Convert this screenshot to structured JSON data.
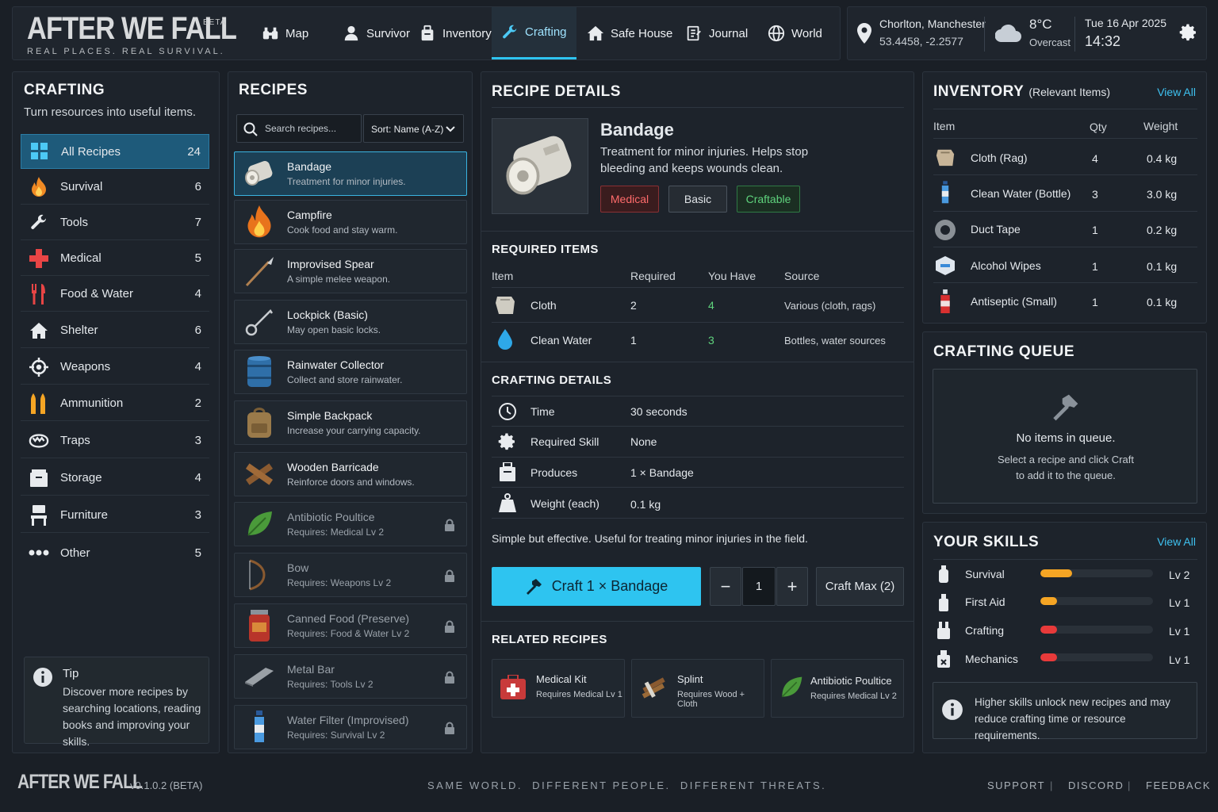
{
  "header": {
    "logo": "AFTER WE FALL",
    "beta": "BETA",
    "tagline": "REAL PLACES. REAL SURVIVAL.",
    "nav": [
      {
        "label": "Map",
        "icon": "binoculars-icon"
      },
      {
        "label": "Survivor",
        "icon": "person-icon"
      },
      {
        "label": "Inventory",
        "icon": "backpack-icon"
      },
      {
        "label": "Crafting",
        "icon": "wrench-icon",
        "active": true
      },
      {
        "label": "Safe House",
        "icon": "house-icon"
      },
      {
        "label": "Journal",
        "icon": "journal-icon"
      },
      {
        "label": "World",
        "icon": "globe-icon"
      }
    ],
    "location": "Chorlton, Manchester",
    "coords": "53.4458, -2.2577",
    "temp": "8°C",
    "weather": "Overcast",
    "date": "Tue 16 Apr 2025",
    "time": "14:32"
  },
  "sidebar": {
    "title": "CRAFTING",
    "subtitle": "Turn resources into useful items.",
    "categories": [
      {
        "label": "All Recipes",
        "count": "24",
        "icon": "grid-icon"
      },
      {
        "label": "Survival",
        "count": "6",
        "icon": "fire-icon"
      },
      {
        "label": "Tools",
        "count": "7",
        "icon": "wrench-icon"
      },
      {
        "label": "Medical",
        "count": "5",
        "icon": "medical-cross-icon"
      },
      {
        "label": "Food & Water",
        "count": "4",
        "icon": "cutlery-icon"
      },
      {
        "label": "Shelter",
        "count": "6",
        "icon": "house-icon"
      },
      {
        "label": "Weapons",
        "count": "4",
        "icon": "crosshair-icon"
      },
      {
        "label": "Ammunition",
        "count": "2",
        "icon": "bullets-icon"
      },
      {
        "label": "Traps",
        "count": "3",
        "icon": "trap-icon"
      },
      {
        "label": "Storage",
        "count": "4",
        "icon": "box-icon"
      },
      {
        "label": "Furniture",
        "count": "3",
        "icon": "chair-icon"
      },
      {
        "label": "Other",
        "count": "5",
        "icon": "dots-icon"
      }
    ],
    "tip_title": "Tip",
    "tip_text": "Discover more recipes by searching locations, reading books and improving your skills."
  },
  "recipes": {
    "title": "RECIPES",
    "search_placeholder": "Search recipes...",
    "sort": "Sort: Name (A-Z)",
    "items": [
      {
        "name": "Bandage",
        "desc": "Treatment for minor injuries."
      },
      {
        "name": "Campfire",
        "desc": "Cook food and stay warm."
      },
      {
        "name": "Improvised Spear",
        "desc": "A simple melee weapon."
      },
      {
        "name": "Lockpick (Basic)",
        "desc": "May open basic locks."
      },
      {
        "name": "Rainwater Collector",
        "desc": "Collect and store rainwater."
      },
      {
        "name": "Simple Backpack",
        "desc": "Increase your carrying capacity."
      },
      {
        "name": "Wooden Barricade",
        "desc": "Reinforce doors and windows."
      },
      {
        "name": "Antibiotic Poultice",
        "desc": "Requires: Medical Lv 2"
      },
      {
        "name": "Bow",
        "desc": "Requires: Weapons Lv 2"
      },
      {
        "name": "Canned Food (Preserve)",
        "desc": "Requires: Food & Water Lv 2"
      },
      {
        "name": "Metal Bar",
        "desc": "Requires: Tools Lv 2"
      },
      {
        "name": "Water Filter (Improvised)",
        "desc": "Requires: Survival Lv 2"
      }
    ]
  },
  "details": {
    "title": "RECIPE DETAILS",
    "name": "Bandage",
    "desc": "Treatment for minor injuries. Helps stop bleeding and keeps wounds clean.",
    "tags": [
      "Medical",
      "Basic",
      "Craftable"
    ],
    "req_title": "REQUIRED ITEMS",
    "req_headers": [
      "Item",
      "Required",
      "You Have",
      "Source"
    ],
    "req_rows": [
      {
        "item": "Cloth",
        "required": "2",
        "have": "4",
        "source": "Various (cloth, rags)"
      },
      {
        "item": "Clean Water",
        "required": "1",
        "have": "3",
        "source": "Bottles, water sources"
      }
    ],
    "craft_title": "CRAFTING DETAILS",
    "craft_rows": [
      {
        "label": "Time",
        "value": "30 seconds"
      },
      {
        "label": "Required Skill",
        "value": "None"
      },
      {
        "label": "Produces",
        "value": "1 × Bandage"
      },
      {
        "label": "Weight (each)",
        "value": "0.1 kg"
      }
    ],
    "note": "Simple but effective. Useful for treating minor injuries in the field.",
    "craft_button": "Craft 1 × Bandage",
    "qty": "1",
    "craft_max": "Craft Max (2)",
    "related_title": "RELATED RECIPES",
    "related": [
      {
        "name": "Medical Kit",
        "req": "Requires Medical Lv 1"
      },
      {
        "name": "Splint",
        "req": "Requires Wood + Cloth"
      },
      {
        "name": "Antibiotic Poultice",
        "req": "Requires Medical Lv 2"
      }
    ]
  },
  "inventory": {
    "title": "INVENTORY",
    "subtitle": "(Relevant Items)",
    "view_all": "View All",
    "headers": [
      "Item",
      "Qty",
      "Weight"
    ],
    "rows": [
      {
        "item": "Cloth (Rag)",
        "qty": "4",
        "weight": "0.4 kg"
      },
      {
        "item": "Clean Water (Bottle)",
        "qty": "3",
        "weight": "3.0 kg"
      },
      {
        "item": "Duct Tape",
        "qty": "1",
        "weight": "0.2 kg"
      },
      {
        "item": "Alcohol Wipes",
        "qty": "1",
        "weight": "0.1 kg"
      },
      {
        "item": "Antiseptic (Small)",
        "qty": "1",
        "weight": "0.1 kg"
      }
    ]
  },
  "queue": {
    "title": "CRAFTING QUEUE",
    "empty": "No items in queue.",
    "hint1": "Select a recipe and click Craft",
    "hint2": "to add it to the queue."
  },
  "skills": {
    "title": "YOUR SKILLS",
    "view_all": "View All",
    "rows": [
      {
        "name": "Survival",
        "level": "Lv 2",
        "progress": 0.28,
        "color": "#f5a524"
      },
      {
        "name": "First Aid",
        "level": "Lv 1",
        "progress": 0.15,
        "color": "#f5a524"
      },
      {
        "name": "Crafting",
        "level": "Lv 1",
        "progress": 0.15,
        "color": "#e83a3a"
      },
      {
        "name": "Mechanics",
        "level": "Lv 1",
        "progress": 0.15,
        "color": "#e83a3a"
      }
    ],
    "info": "Higher skills unlock new recipes and may reduce crafting time or resource requirements."
  },
  "footer": {
    "logo": "AFTER WE FALL",
    "version": "v0.1.0.2 (BETA)",
    "slogan": "SAME WORLD.  DIFFERENT PEOPLE.  DIFFERENT THREATS.",
    "links": [
      "SUPPORT",
      "DISCORD",
      "FEEDBACK"
    ]
  }
}
